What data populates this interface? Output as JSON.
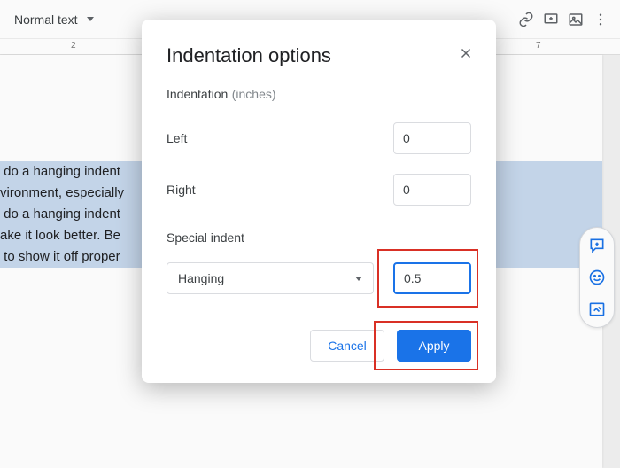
{
  "toolbar": {
    "style_label": "Normal text"
  },
  "ruler": {
    "marks": [
      "2",
      "7"
    ]
  },
  "document": {
    "lines": [
      " do a hanging indent",
      "vironment, especially",
      " do a hanging indent",
      "ake it look better. Be",
      " to show it off proper"
    ]
  },
  "dialog": {
    "title": "Indentation options",
    "section_label": "Indentation",
    "section_unit": "(inches)",
    "left_label": "Left",
    "left_value": "0",
    "right_label": "Right",
    "right_value": "0",
    "special_label": "Special indent",
    "special_select": "Hanging",
    "special_value": "0.5",
    "cancel": "Cancel",
    "apply": "Apply"
  }
}
